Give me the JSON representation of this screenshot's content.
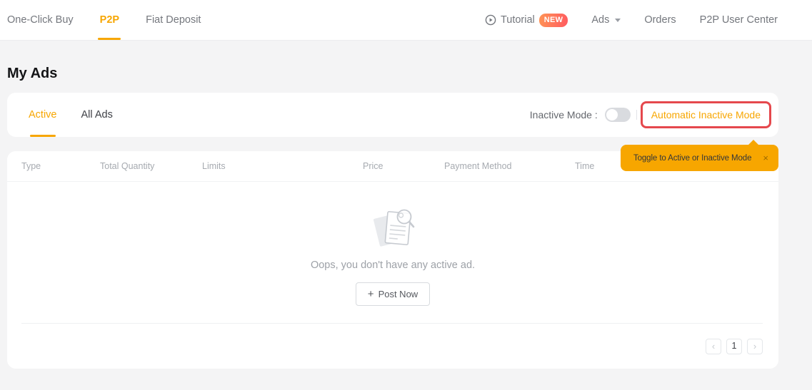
{
  "topnav": {
    "items": [
      {
        "label": "One-Click Buy",
        "active": false
      },
      {
        "label": "P2P",
        "active": true
      },
      {
        "label": "Fiat Deposit",
        "active": false
      }
    ],
    "tutorial": {
      "label": "Tutorial",
      "badge": "NEW"
    },
    "ads_menu": {
      "label": "Ads"
    },
    "orders": {
      "label": "Orders"
    },
    "user_center": {
      "label": "P2P User Center"
    }
  },
  "page": {
    "title": "My Ads"
  },
  "tabs": {
    "active_tab": "Active",
    "all_ads_tab": "All Ads"
  },
  "mode_control": {
    "label": "Inactive Mode :",
    "toggle_state": "off",
    "link": "Automatic Inactive Mode"
  },
  "tooltip": {
    "text": "Toggle to Active or Inactive Mode",
    "close": "×"
  },
  "table": {
    "headers": [
      "Type",
      "Total Quantity",
      "Limits",
      "Price",
      "Payment Method",
      "Time"
    ]
  },
  "empty_state": {
    "message": "Oops, you don't have any active ad.",
    "button_plus": "+",
    "button_label": "Post Now"
  },
  "pagination": {
    "prev": "‹",
    "current_page": "1",
    "next": "›"
  },
  "colors": {
    "accent_orange": "#f7a600",
    "highlight_red": "#e5484d",
    "tooltip_bg": "#f7a600",
    "badge_gradient_start": "#ff9455",
    "badge_gradient_end": "#ff5a60",
    "page_bg": "#f4f4f5"
  }
}
